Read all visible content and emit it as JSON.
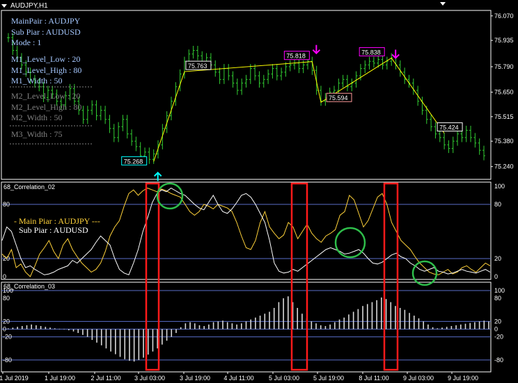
{
  "window": {
    "symbol_title": "AUDJPY,H1"
  },
  "colors": {
    "background": "#000000",
    "bars": "#32cd32",
    "zigzag": "#ffff00",
    "label_text": "#a6c8ff",
    "faded_text": "#808080",
    "cyan": "#00ffff",
    "magenta": "#ff00ff",
    "salmon": "#ff9a9a",
    "yellow": "#ffd23a",
    "white": "#ffffff",
    "level_line": "#5a6ec8",
    "red_box": "#ff1a1a",
    "green_circle": "#2ebd4a"
  },
  "main_panel": {
    "info_lines": [
      "MainPair : AUDJPY",
      "Sub Piar : AUDUSD",
      "Mode : 1"
    ],
    "settings_active": [
      "M1_Level_Low : 20",
      "M1_Level_High : 80",
      "M1_Width : 50"
    ],
    "settings_faded": [
      "M2_Level_Low : 20",
      "M2_Level_High : 80",
      "M2_Width : 50",
      "M3_Width : 75"
    ],
    "price_labels": [
      {
        "text": "75.268",
        "color": "cyan"
      },
      {
        "text": "75.763",
        "color": "white"
      },
      {
        "text": "75.818",
        "color": "magenta"
      },
      {
        "text": "75.594",
        "color": "salmon"
      },
      {
        "text": "75.838",
        "color": "magenta"
      },
      {
        "text": "75.424",
        "color": "white"
      }
    ],
    "arrows": [
      {
        "name": "buy-arrow-icon",
        "dir": "up",
        "color": "cyan"
      },
      {
        "name": "sell-arrow-icon",
        "dir": "down",
        "color": "magenta"
      },
      {
        "name": "sell-arrow-icon",
        "dir": "down",
        "color": "magenta"
      }
    ]
  },
  "panel2": {
    "title": "68_Correlation_02",
    "legend_main": "- Main Piar : AUDJPY ---",
    "legend_sub": "Sub Piar : AUDUSD"
  },
  "panel3": {
    "title": "68_Correlation_03"
  },
  "chart_data": [
    {
      "type": "bar",
      "name": "AUDJPY,H1",
      "ylim": [
        75.17,
        76.1
      ],
      "yticks": [
        "76.070",
        "75.935",
        "75.790",
        "75.650",
        "75.515",
        "75.380",
        "75.240"
      ],
      "x_labels": [
        "1 Jul 2019",
        "1 Jul 19:00",
        "2 Jul 11:00",
        "3 Jul 03:00",
        "3 Jul 19:00",
        "4 Jul 11:00",
        "5 Jul 03:00",
        "5 Jul 19:00",
        "8 Jul 11:00",
        "9 Jul 03:00",
        "9 Jul 19:00"
      ],
      "close_approx": [
        75.95,
        75.88,
        75.84,
        75.8,
        75.76,
        75.72,
        75.7,
        75.68,
        75.62,
        75.66,
        75.64,
        75.6,
        75.58,
        75.63,
        75.67,
        75.6,
        75.55,
        75.5,
        75.55,
        75.58,
        75.52,
        75.55,
        75.5,
        75.45,
        75.4,
        75.46,
        75.5,
        75.42,
        75.38,
        75.35,
        75.3,
        75.32,
        75.28,
        75.31,
        75.36,
        75.45,
        75.52,
        75.6,
        75.68,
        75.75,
        75.82,
        75.86,
        75.88,
        75.85,
        75.8,
        75.84,
        75.8,
        75.76,
        75.72,
        75.78,
        75.74,
        75.7,
        75.66,
        75.7,
        75.72,
        75.78,
        75.74,
        75.7,
        75.72,
        75.75,
        75.78,
        75.74,
        75.76,
        75.79,
        75.8,
        75.81,
        75.78,
        75.8,
        75.82,
        75.77,
        75.66,
        75.6,
        75.62,
        75.65,
        75.66,
        75.7,
        75.72,
        75.68,
        75.7,
        75.74,
        75.78,
        75.8,
        75.82,
        75.81,
        75.83,
        75.8,
        75.82,
        75.84,
        75.8,
        75.76,
        75.72,
        75.7,
        75.66,
        75.6,
        75.55,
        75.5,
        75.46,
        75.42,
        75.4,
        75.36,
        75.34,
        75.38,
        75.42,
        75.4,
        75.44,
        75.4,
        75.37,
        75.33,
        75.3
      ],
      "zigzag": [
        {
          "x": "2 Jul 23:00",
          "y": 75.268
        },
        {
          "x": "3 Jul 16:00",
          "y": 75.763
        },
        {
          "x": "5 Jul 07:00",
          "y": 75.818
        },
        {
          "x": "5 Jul 12:00",
          "y": 75.594
        },
        {
          "x": "8 Jul 15:00",
          "y": 75.838
        },
        {
          "x": "9 Jul 04:00",
          "y": 75.424
        }
      ]
    },
    {
      "type": "line",
      "name": "68_Correlation_02",
      "ylim": [
        0,
        100
      ],
      "levels": [
        20,
        80
      ],
      "yticks": [
        "100",
        "80",
        "20",
        "0"
      ],
      "series": [
        {
          "name": "Main Piar : AUDJPY",
          "color": "yellow",
          "values": [
            25,
            20,
            30,
            10,
            14,
            5,
            0,
            12,
            25,
            32,
            40,
            28,
            20,
            35,
            42,
            30,
            22,
            15,
            10,
            5,
            8,
            15,
            28,
            45,
            55,
            62,
            78,
            92,
            96,
            90,
            95,
            98,
            96,
            94,
            97,
            95,
            92,
            90,
            88,
            80,
            72,
            68,
            72,
            80,
            78,
            75,
            80,
            78,
            76,
            72,
            60,
            45,
            32,
            30,
            40,
            60,
            72,
            55,
            48,
            42,
            46,
            60,
            55,
            42,
            50,
            58,
            48,
            42,
            38,
            45,
            48,
            52,
            68,
            72,
            90,
            85,
            70,
            55,
            62,
            75,
            88,
            92,
            80,
            60,
            50,
            40,
            35,
            30,
            22,
            15,
            10,
            5,
            3,
            2,
            5,
            8,
            3,
            5,
            10,
            12,
            8,
            5,
            10,
            15,
            12
          ]
        },
        {
          "name": "Sub Piar : AUDUSD",
          "color": "white",
          "values": [
            40,
            55,
            50,
            35,
            20,
            10,
            12,
            8,
            5,
            2,
            3,
            5,
            8,
            10,
            12,
            18,
            15,
            20,
            25,
            30,
            38,
            45,
            40,
            35,
            20,
            8,
            4,
            2,
            15,
            30,
            50,
            65,
            82,
            92,
            96,
            94,
            98,
            95,
            92,
            90,
            85,
            80,
            76,
            74,
            82,
            90,
            80,
            72,
            70,
            75,
            82,
            90,
            92,
            88,
            80,
            70,
            60,
            40,
            15,
            6,
            4,
            5,
            8,
            6,
            10,
            14,
            18,
            22,
            26,
            30,
            32,
            30,
            28,
            25,
            26,
            28,
            30,
            26,
            20,
            15,
            14,
            16,
            20,
            24,
            26,
            22,
            20,
            15,
            12,
            8,
            6,
            8,
            10,
            6,
            5,
            3,
            4,
            6,
            8,
            6,
            5,
            4,
            6,
            8,
            5
          ]
        }
      ]
    },
    {
      "type": "bar",
      "name": "68_Correlation_03",
      "ylim": [
        -100,
        100
      ],
      "levels": [
        100,
        20,
        0,
        -20,
        -80
      ],
      "yticks": [
        "100",
        "80",
        "20",
        "0",
        "-20",
        "-80"
      ],
      "values": [
        0,
        2,
        4,
        6,
        8,
        10,
        12,
        10,
        8,
        6,
        4,
        2,
        1,
        -1,
        -3,
        -6,
        -10,
        -15,
        -20,
        -28,
        -35,
        -42,
        -50,
        -58,
        -65,
        -72,
        -78,
        -82,
        -84,
        -80,
        -74,
        -66,
        -58,
        -50,
        -40,
        -30,
        -20,
        -10,
        5,
        15,
        18,
        15,
        10,
        8,
        12,
        18,
        20,
        22,
        18,
        15,
        12,
        15,
        20,
        25,
        30,
        35,
        40,
        45,
        55,
        70,
        80,
        85,
        70,
        55,
        40,
        28,
        20,
        15,
        10,
        8,
        12,
        18,
        25,
        30,
        38,
        45,
        52,
        60,
        65,
        70,
        75,
        82,
        78,
        70,
        60,
        55,
        50,
        42,
        35,
        28,
        20,
        12,
        5,
        2,
        4,
        6,
        8,
        10,
        12,
        14,
        16,
        18,
        20,
        22,
        20
      ]
    }
  ]
}
